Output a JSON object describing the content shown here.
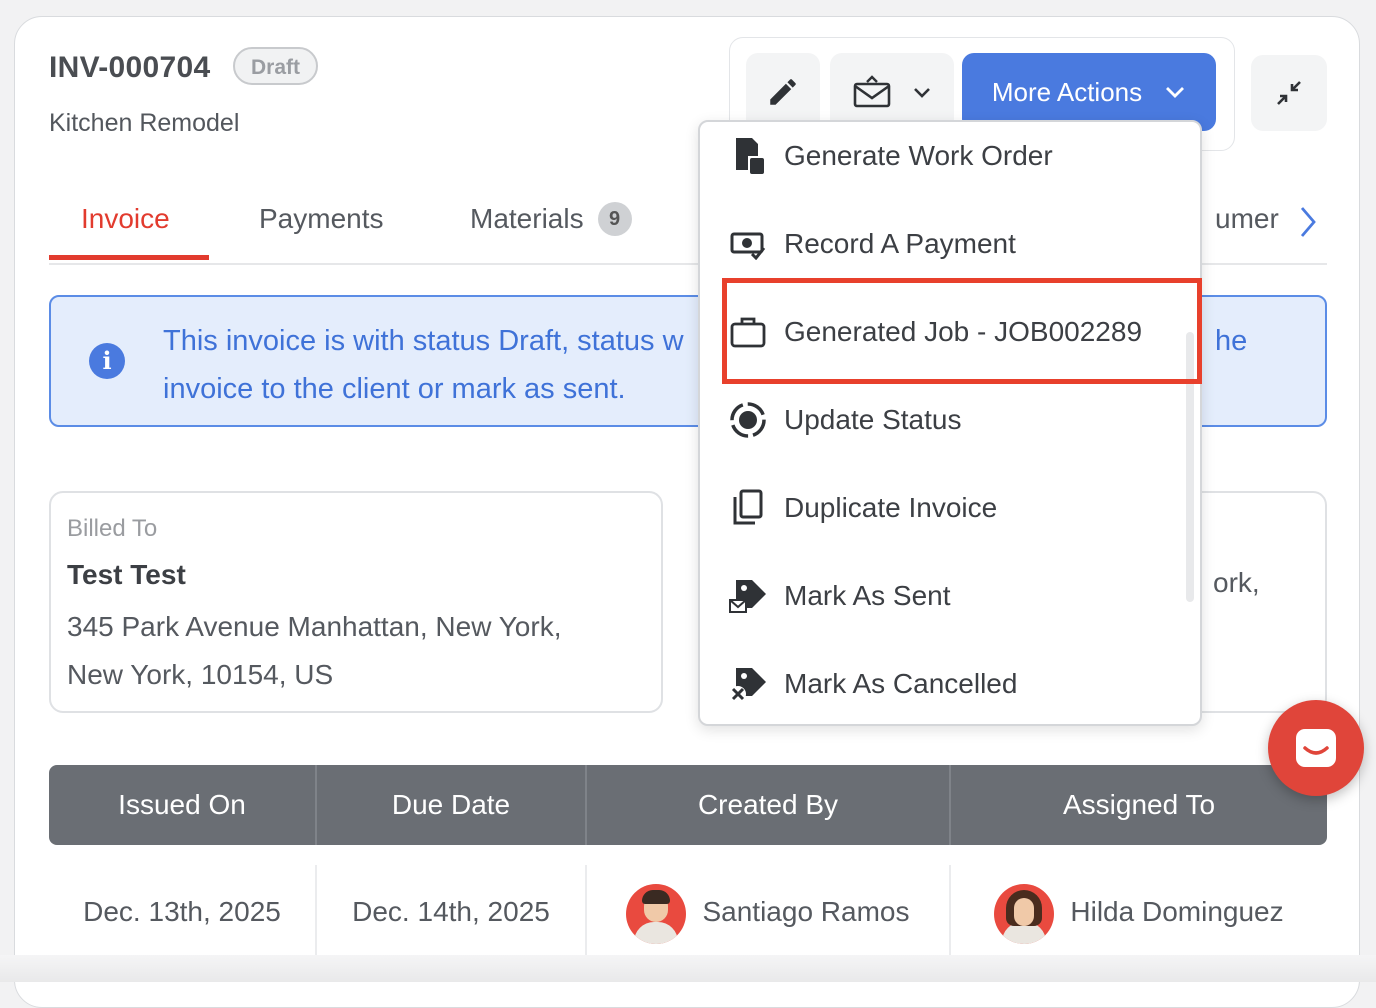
{
  "header": {
    "invoice_number": "INV-000704",
    "status_badge": "Draft",
    "subtitle": "Kitchen Remodel"
  },
  "toolbar": {
    "edit_icon": "pencil-icon",
    "mail_icon": "envelope-icon",
    "more_actions_label": "More Actions",
    "collapse_icon": "collapse-arrows-icon"
  },
  "tabs": [
    {
      "label": "Invoice",
      "active": true
    },
    {
      "label": "Payments"
    },
    {
      "label": "Materials",
      "count": "9"
    },
    {
      "label": "umer",
      "note": "partially hidden tab"
    }
  ],
  "alert": {
    "text_line1": "This invoice is with status Draft, status w",
    "text_line1_right": "he",
    "text_line2": "invoice to the client or mark as sent.",
    "accent": "#4a7adf"
  },
  "billed_to": {
    "label": "Billed To",
    "name": "Test Test",
    "address_line1": "345 Park Avenue Manhattan, New York,",
    "address_line2": "New York, 10154, US"
  },
  "second_card": {
    "visible_fragment": "ork,"
  },
  "table": {
    "headers": [
      "Issued On",
      "Due Date",
      "Created By",
      "Assigned To"
    ],
    "row": {
      "issued_on": "Dec. 13th, 2025",
      "due_date": "Dec. 14th, 2025",
      "created_by": "Santiago Ramos",
      "assigned_to": "Hilda Dominguez"
    }
  },
  "more_actions_menu": {
    "items": [
      {
        "label": "Generate Work Order",
        "icon": "work-order-icon"
      },
      {
        "label": "Record A Payment",
        "icon": "payment-icon"
      },
      {
        "label": "Generated Job - JOB002289",
        "icon": "briefcase-icon",
        "highlighted": true
      },
      {
        "label": "Update Status",
        "icon": "status-icon"
      },
      {
        "label": "Duplicate Invoice",
        "icon": "duplicate-icon"
      },
      {
        "label": "Mark As Sent",
        "icon": "tag-mail-icon"
      },
      {
        "label": "Mark As Cancelled",
        "icon": "tag-cancel-icon"
      }
    ]
  },
  "colors": {
    "primary": "#4a7adf",
    "accent_red": "#e23b2e",
    "highlight_box": "#e8402c",
    "chat": "#e0453a"
  }
}
